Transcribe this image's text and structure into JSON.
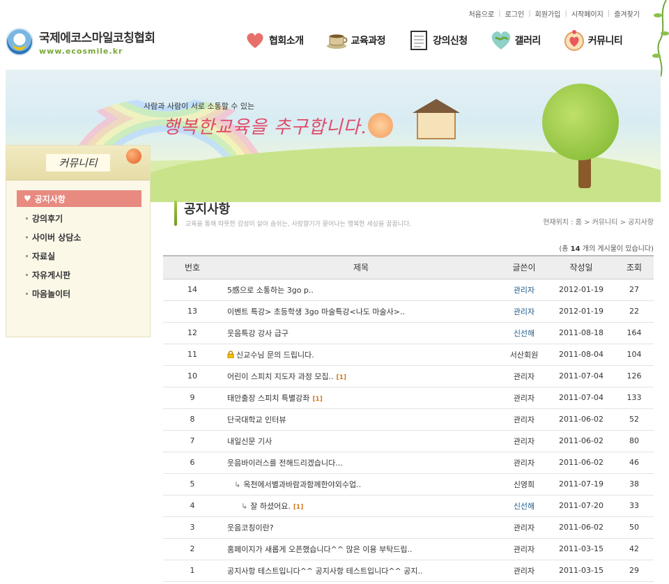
{
  "utility_links": [
    "처음으로",
    "로그인",
    "회원가입",
    "시작페이지",
    "즐겨찾기"
  ],
  "logo": {
    "title": "국제에코스마일코칭협회",
    "url": "www.ecosmile.kr"
  },
  "gnb": [
    {
      "label": "협회소개",
      "icon": "heart-icon"
    },
    {
      "label": "교육과정",
      "icon": "coffee-cup-icon"
    },
    {
      "label": "강의신청",
      "icon": "notepad-icon"
    },
    {
      "label": "갤러리",
      "icon": "heart-globe-icon"
    },
    {
      "label": "커뮤니티",
      "icon": "cupid-icon"
    }
  ],
  "banner": {
    "subtext": "사람과 사람이 서로 소통할 수 있는",
    "slogan": "행복한교육을 추구합니다."
  },
  "lnb": {
    "title": "커뮤니티",
    "items": [
      "공지사항",
      "강의후기",
      "사이버 상담소",
      "자료실",
      "자유게시판",
      "마음놀이터"
    ],
    "active_index": 0
  },
  "page": {
    "title": "공지사항",
    "description": "교육을 통해 따뜻한 감성이 살아 숨쉬는, 사랑향기가 묻어나는 행복한 세상을 꿈꿉니다.",
    "breadcrumb": "현재위치 : 홈 > 커뮤니티 > 공지사항",
    "total_prefix": "(총 ",
    "total_count": "14",
    "total_suffix": " 개의 게시물이 있습니다)"
  },
  "table": {
    "headers": [
      "번호",
      "제목",
      "글쓴이",
      "작성일",
      "조회"
    ],
    "rows": [
      {
        "num": "14",
        "subject": "5感으로 소통하는 3go p..",
        "reply_depth": 0,
        "comments": "",
        "locked": false,
        "author": "관리자",
        "author_admin": true,
        "date": "2012-01-19",
        "views": "27"
      },
      {
        "num": "13",
        "subject": "이벤트 특강> 초등학생 3go 마술특강<나도 마술사>..",
        "reply_depth": 0,
        "comments": "",
        "locked": false,
        "author": "관리자",
        "author_admin": true,
        "date": "2012-01-19",
        "views": "22"
      },
      {
        "num": "12",
        "subject": "웃음특강 강사 급구",
        "reply_depth": 0,
        "comments": "",
        "locked": false,
        "author": "신선해",
        "author_admin": true,
        "date": "2011-08-18",
        "views": "164"
      },
      {
        "num": "11",
        "subject": "신교수님 문의 드립니다.",
        "reply_depth": 0,
        "comments": "",
        "locked": true,
        "author": "서산회원",
        "author_admin": false,
        "date": "2011-08-04",
        "views": "104"
      },
      {
        "num": "10",
        "subject": "어린이 스피치 지도자 과정 모집..",
        "reply_depth": 0,
        "comments": "[1]",
        "locked": false,
        "author": "관리자",
        "author_admin": false,
        "date": "2011-07-04",
        "views": "126"
      },
      {
        "num": "9",
        "subject": "태안출장 스피치 특별강좌",
        "reply_depth": 0,
        "comments": "[1]",
        "locked": false,
        "author": "관리자",
        "author_admin": false,
        "date": "2011-07-04",
        "views": "133"
      },
      {
        "num": "8",
        "subject": "단국대학교 인터뷰",
        "reply_depth": 0,
        "comments": "",
        "locked": false,
        "author": "관리자",
        "author_admin": false,
        "date": "2011-06-02",
        "views": "52"
      },
      {
        "num": "7",
        "subject": "내일신문 기사",
        "reply_depth": 0,
        "comments": "",
        "locked": false,
        "author": "관리자",
        "author_admin": false,
        "date": "2011-06-02",
        "views": "80"
      },
      {
        "num": "6",
        "subject": "웃음바이러스를 전해드리겠습니다...",
        "reply_depth": 0,
        "comments": "",
        "locked": false,
        "author": "관리자",
        "author_admin": false,
        "date": "2011-06-02",
        "views": "46"
      },
      {
        "num": "5",
        "subject": "옥천에서별과바람과함께한야외수업..",
        "reply_depth": 1,
        "comments": "",
        "locked": false,
        "author": "신영희",
        "author_admin": false,
        "date": "2011-07-19",
        "views": "38"
      },
      {
        "num": "4",
        "subject": "잘 하셨어요.",
        "reply_depth": 2,
        "comments": "[1]",
        "locked": false,
        "author": "신선해",
        "author_admin": true,
        "date": "2011-07-20",
        "views": "33"
      },
      {
        "num": "3",
        "subject": "웃음코칭이란?",
        "reply_depth": 0,
        "comments": "",
        "locked": false,
        "author": "관리자",
        "author_admin": false,
        "date": "2011-06-02",
        "views": "50"
      },
      {
        "num": "2",
        "subject": "홈페이지가 새롭게 오픈했습니다^^ 많은 이용 부탁드립..",
        "reply_depth": 0,
        "comments": "",
        "locked": false,
        "author": "관리자",
        "author_admin": false,
        "date": "2011-03-15",
        "views": "42"
      },
      {
        "num": "1",
        "subject": "공지사항 테스트입니다^^ 공지사항 테스트입니다^^ 공지..",
        "reply_depth": 0,
        "comments": "",
        "locked": false,
        "author": "관리자",
        "author_admin": false,
        "date": "2011-03-15",
        "views": "29"
      }
    ]
  },
  "colors": {
    "accent_pink": "#e88a80",
    "admin_blue": "#1e5a8a",
    "comment_orange": "#d07a20",
    "green_bar": "#8ab53a"
  }
}
